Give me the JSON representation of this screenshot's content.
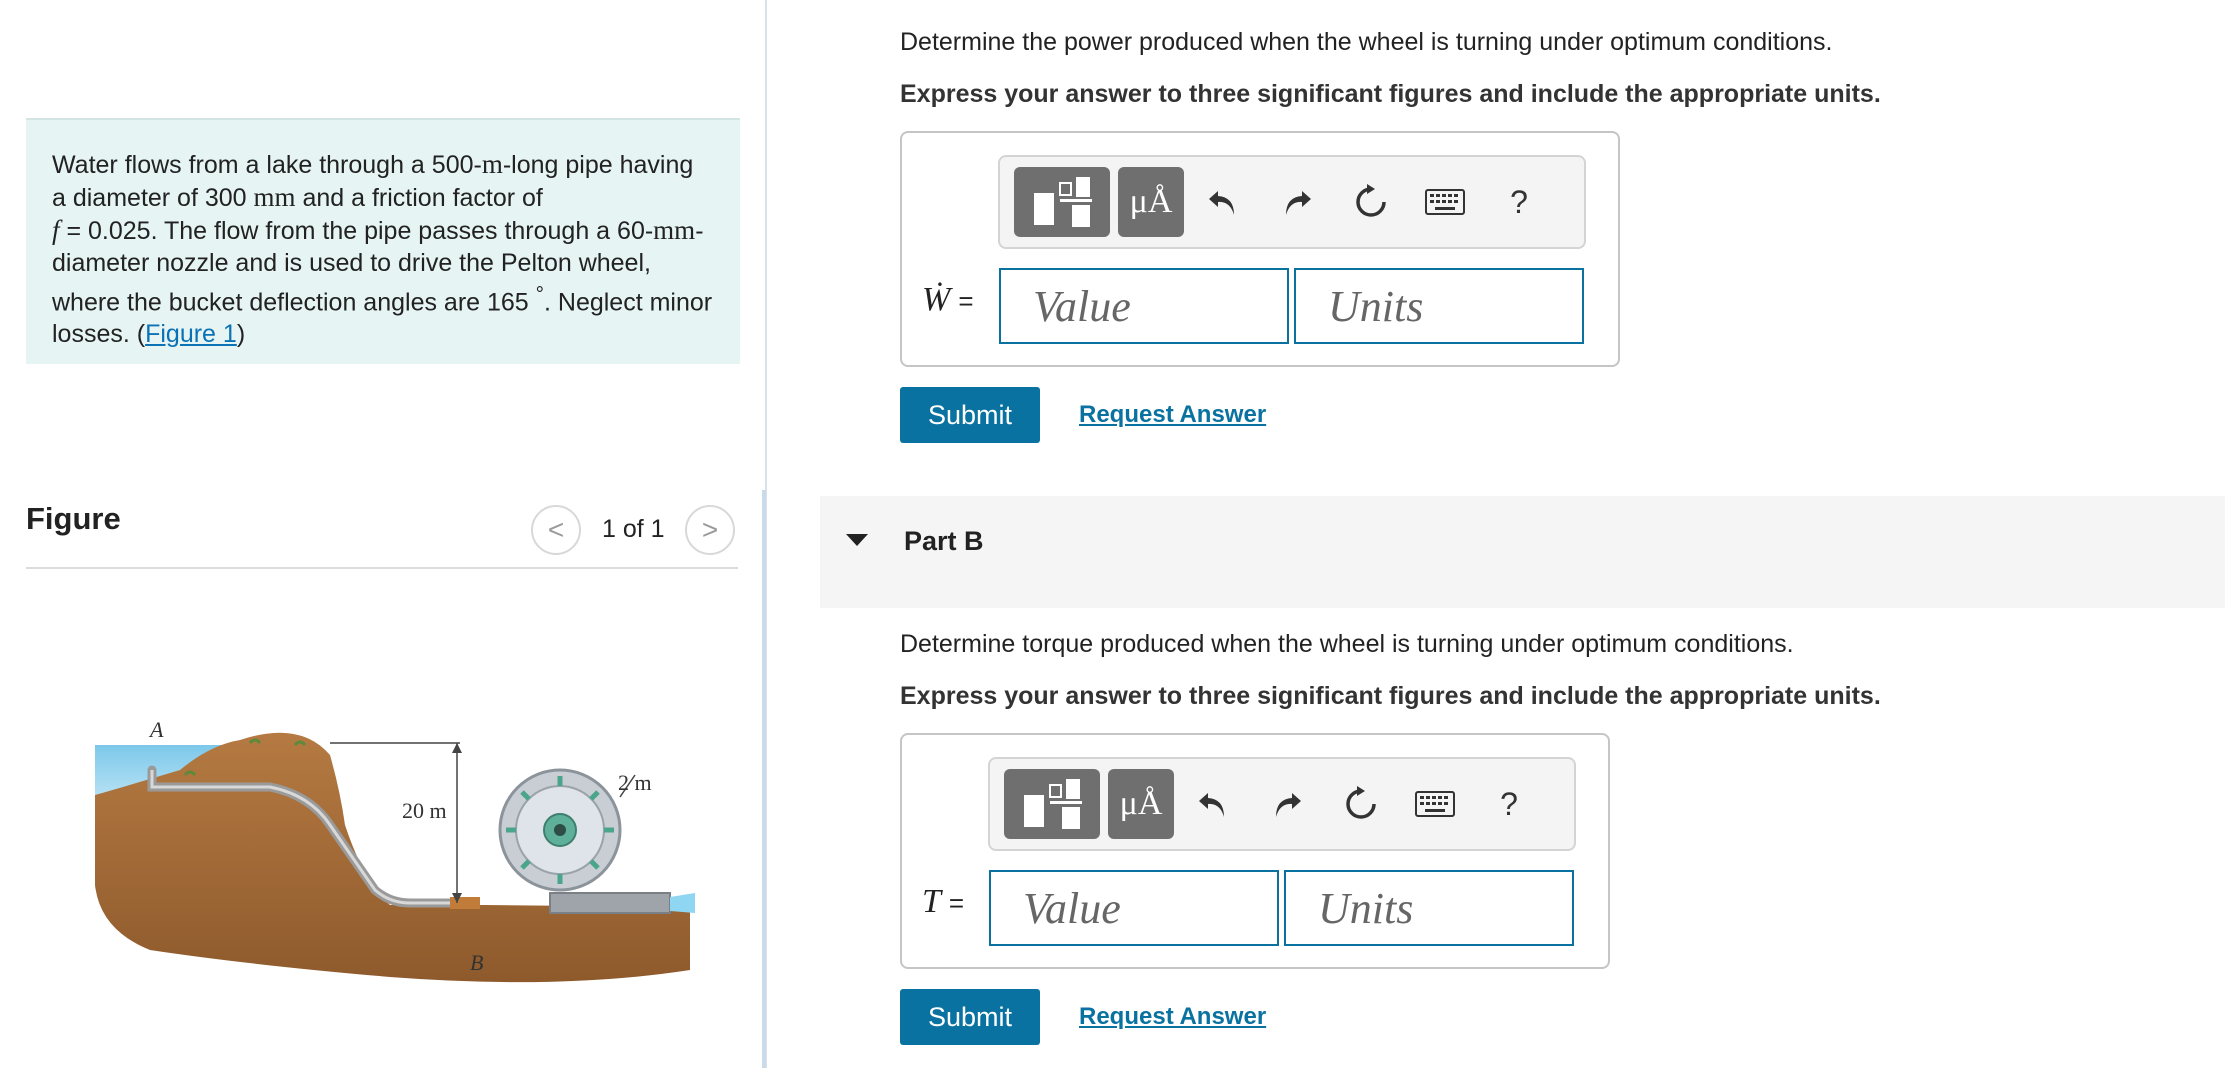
{
  "problem": {
    "t1": "Water flows from a lake through a 500-",
    "u1": "m",
    "t2": "-long pipe having a diameter of 300 ",
    "u2": "mm",
    "t3": " and a friction factor of ",
    "var_f": "f",
    "t4": " = 0.025. The flow from the pipe passes through a 60-",
    "u3": "mm",
    "t5": "-diameter nozzle and is used to drive the Pelton wheel, where the bucket deflection angles are 165 ",
    "deg": "°",
    "t6": ". Neglect minor losses. (",
    "link": "Figure 1",
    "t7": ")"
  },
  "figure": {
    "title": "Figure",
    "prev": "<",
    "next": ">",
    "counter": "1 of 1",
    "labels": {
      "a": "A",
      "b": "B",
      "h": "20 m",
      "d": "2 m"
    }
  },
  "partA": {
    "instruction": "Determine the power produced when the wheel is turning under optimum conditions.",
    "express": "Express your answer to three significant figures and include the appropriate units.",
    "label": "Ẇ",
    "eq": "=",
    "value_placeholder": "Value",
    "units_placeholder": "Units",
    "submit": "Submit",
    "request": "Request Answer"
  },
  "partB": {
    "header": "Part B",
    "instruction": "Determine torque produced when the wheel is turning under optimum conditions.",
    "express": "Express your answer to three significant figures and include the appropriate units.",
    "label": "T",
    "eq": "=",
    "value_placeholder": "Value",
    "units_placeholder": "Units",
    "submit": "Submit",
    "request": "Request Answer"
  },
  "toolbar": {
    "symbols": "μÅ",
    "help": "?",
    "icons": [
      "templates-icon",
      "symbols-icon",
      "undo-icon",
      "redo-icon",
      "reset-icon",
      "keyboard-icon",
      "help-icon"
    ]
  },
  "colors": {
    "accent": "#0a72a0",
    "problem_bg": "#e6f4f4",
    "toolbar_btn": "#6f6f6f"
  }
}
